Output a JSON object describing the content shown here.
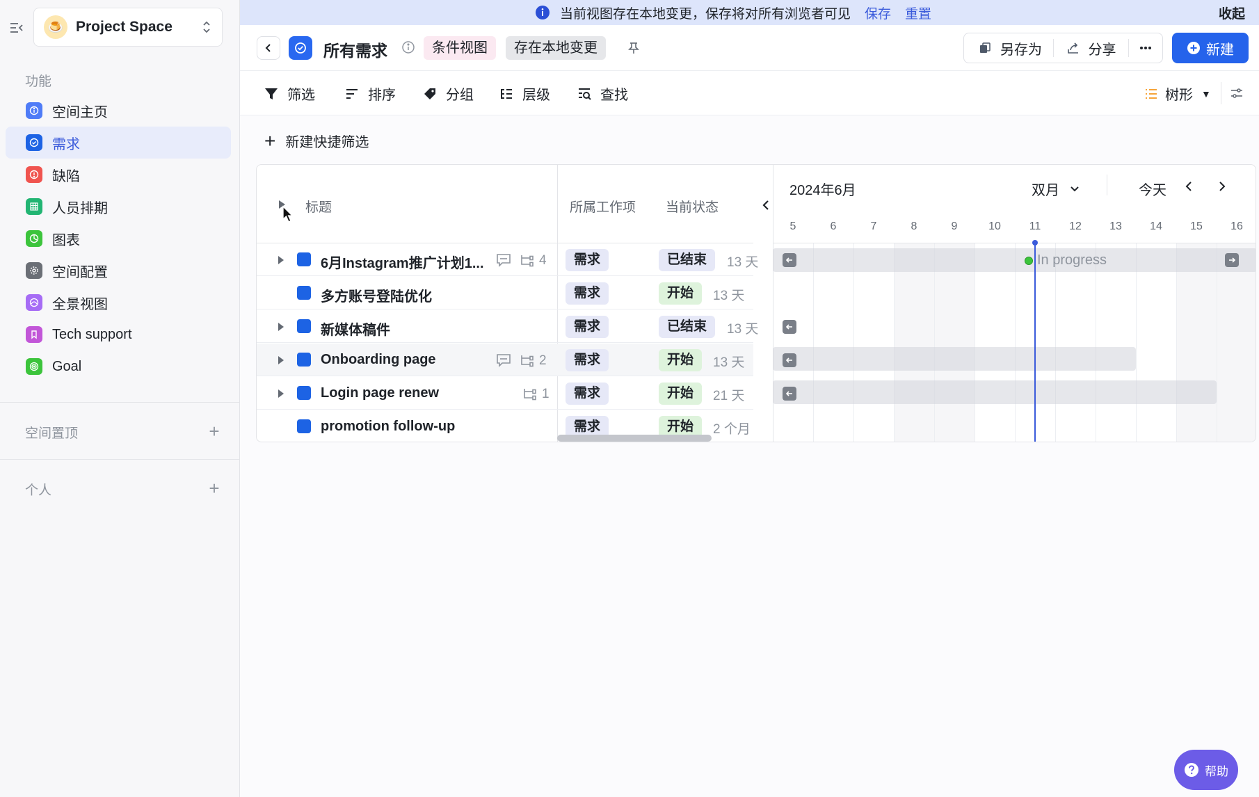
{
  "sidebar": {
    "space_name": "Project Space",
    "section_features": "功能",
    "items": [
      {
        "label": "空间主页",
        "color": "#4f7cf7"
      },
      {
        "label": "需求",
        "color": "#1d63e4"
      },
      {
        "label": "缺陷",
        "color": "#f0544f"
      },
      {
        "label": "人员排期",
        "color": "#22b573"
      },
      {
        "label": "图表",
        "color": "#3cc43c"
      },
      {
        "label": "空间配置",
        "color": "#6b6f76"
      },
      {
        "label": "全景视图",
        "color": "#a66cf5"
      },
      {
        "label": "Tech support",
        "color": "#c256d8"
      },
      {
        "label": "Goal",
        "color": "#3cc43c"
      }
    ],
    "section_pinned": "空间置顶",
    "section_personal": "个人"
  },
  "banner": {
    "text": "当前视图存在本地变更，保存将对所有浏览者可见",
    "save": "保存",
    "reset": "重置",
    "collapse": "收起"
  },
  "titlebar": {
    "title": "所有需求",
    "tag_condition": "条件视图",
    "tag_local": "存在本地变更",
    "save_as": "另存为",
    "share": "分享",
    "new": "新建"
  },
  "toolbar": {
    "filter": "筛选",
    "sort": "排序",
    "group": "分组",
    "level": "层级",
    "find": "查找",
    "view_mode": "树形"
  },
  "quick_filter": "新建快捷筛选",
  "table": {
    "headers": {
      "title": "标题",
      "workitem": "所属工作项",
      "status": "当前状态"
    },
    "rows": [
      {
        "title": "6月Instagram推广计划1...",
        "type": "需求",
        "status": "已结束",
        "duration": "13 天",
        "subcount": "4",
        "has_comment": true,
        "expandable": true
      },
      {
        "title": "多方账号登陆优化",
        "type": "需求",
        "status": "开始",
        "duration": "13 天",
        "subcount": "",
        "has_comment": false,
        "expandable": false
      },
      {
        "title": "新媒体稿件",
        "type": "需求",
        "status": "已结束",
        "duration": "13 天",
        "subcount": "",
        "has_comment": false,
        "expandable": true
      },
      {
        "title": "Onboarding page",
        "type": "需求",
        "status": "开始",
        "duration": "13 天",
        "subcount": "2",
        "has_comment": true,
        "expandable": true
      },
      {
        "title": "Login page renew",
        "type": "需求",
        "status": "开始",
        "duration": "21 天",
        "subcount": "1",
        "has_comment": false,
        "expandable": true
      },
      {
        "title": "promotion follow-up",
        "type": "需求",
        "status": "开始",
        "duration": "2 个月",
        "subcount": "",
        "has_comment": false,
        "expandable": false
      }
    ]
  },
  "gantt": {
    "month": "2024年6月",
    "scale": "双月",
    "today": "今天",
    "days": [
      "5",
      "6",
      "7",
      "8",
      "9",
      "10",
      "11",
      "12",
      "13",
      "14",
      "15",
      "16"
    ],
    "progress_label": "In progress"
  },
  "help": "帮助"
}
